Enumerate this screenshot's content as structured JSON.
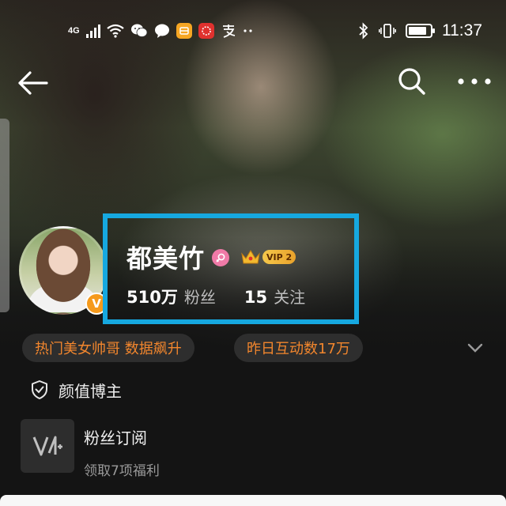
{
  "status_bar": {
    "network": "4G",
    "time": "11:37",
    "battery_level": 0.85,
    "icons": [
      "signal-icon",
      "wifi-icon",
      "wechat-icon",
      "message-icon",
      "orange-app-icon",
      "red-app-icon",
      "alipay-icon",
      "more-dots-icon",
      "bluetooth-icon",
      "vibrate-icon",
      "battery-icon"
    ]
  },
  "nav": {
    "icons": [
      "back-arrow-icon",
      "search-icon",
      "more-icon"
    ]
  },
  "profile": {
    "username": "都美竹",
    "vip_label": "VIP 2",
    "verified_badge": "V",
    "stats": {
      "fans_value": "510万",
      "fans_label": "粉丝",
      "following_value": "15",
      "following_label": "关注"
    }
  },
  "tags": [
    "热门美女帅哥 数据飙升",
    "昨日互动数17万"
  ],
  "certification": {
    "text": "颜值博主"
  },
  "subscription": {
    "title": "粉丝订阅",
    "subtitle": "领取7项福利"
  },
  "colors": {
    "background": "#141414",
    "tag_text": "#f2862d",
    "highlight": "#16a8e0",
    "vip_gold": "#f6c84b",
    "gender_pink": "#f07aa7",
    "badge_orange": "#f59a1c"
  }
}
